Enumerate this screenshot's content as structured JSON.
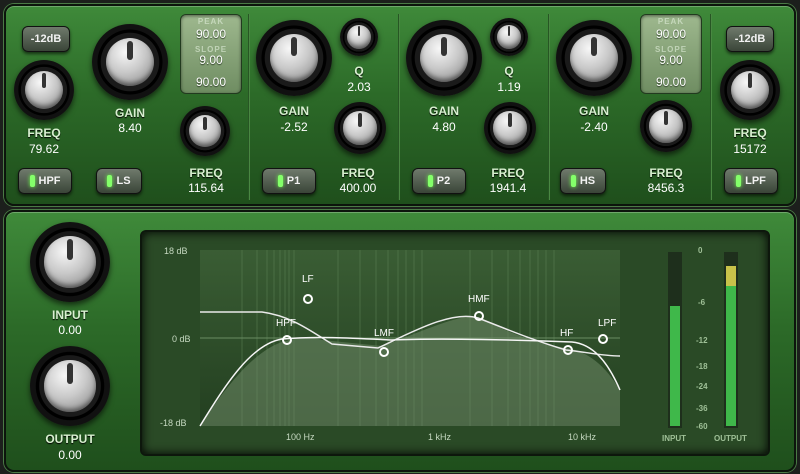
{
  "top": {
    "hpf": {
      "pad_label": "-12dB",
      "label": "FREQ",
      "value": "79.62",
      "button": "HPF"
    },
    "ls": {
      "gain_label": "GAIN",
      "gain_value": "8.40",
      "freq_label": "FREQ",
      "freq_value": "115.64",
      "button": "LS",
      "readout": {
        "peak_label": "PEAK",
        "top": "90.00",
        "slope_label": "SLOPE",
        "mid": "9.00",
        "bottom": "90.00"
      }
    },
    "p1": {
      "gain_label": "GAIN",
      "gain_value": "-2.52",
      "q_label": "Q",
      "q_value": "2.03",
      "freq_label": "FREQ",
      "freq_value": "400.00",
      "button": "P1"
    },
    "p2": {
      "gain_label": "GAIN",
      "gain_value": "4.80",
      "q_label": "Q",
      "q_value": "1.19",
      "freq_label": "FREQ",
      "freq_value": "1941.4",
      "button": "P2"
    },
    "hs": {
      "gain_label": "GAIN",
      "gain_value": "-2.40",
      "freq_label": "FREQ",
      "freq_value": "8456.3",
      "button": "HS",
      "readout": {
        "peak_label": "PEAK",
        "top": "90.00",
        "slope_label": "SLOPE",
        "mid": "9.00",
        "bottom": "90.00"
      }
    },
    "lpf": {
      "pad_label": "-12dB",
      "label": "FREQ",
      "value": "15172",
      "button": "LPF"
    }
  },
  "bottom": {
    "input": {
      "label": "INPUT",
      "value": "0.00"
    },
    "output": {
      "label": "OUTPUT",
      "value": "0.00"
    },
    "graph": {
      "db_labels": [
        "18 dB",
        "0 dB",
        "-18 dB"
      ],
      "freq_labels": [
        "100 Hz",
        "1 kHz",
        "10 kHz"
      ],
      "nodes": [
        "LF",
        "HPF",
        "LMF",
        "HMF",
        "HF",
        "LPF"
      ],
      "meter_scale": [
        "0",
        "-6",
        "-12",
        "-18",
        "-24",
        "-36",
        "-60"
      ],
      "meter_labels": [
        "INPUT",
        "OUTPUT"
      ]
    }
  }
}
